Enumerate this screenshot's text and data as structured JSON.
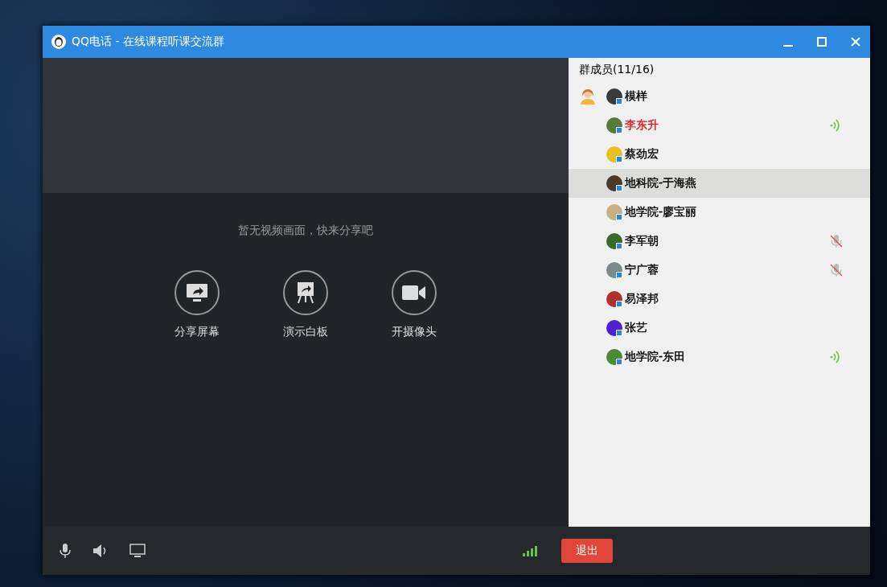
{
  "window": {
    "title": "QQ电话 - 在线课程听课交流群"
  },
  "video": {
    "message": "暂无视频画面，快来分享吧",
    "actions": [
      {
        "kind": "screen",
        "label": "分享屏幕"
      },
      {
        "kind": "whiteboard",
        "label": "演示白板"
      },
      {
        "kind": "camera",
        "label": "开摄像头"
      }
    ]
  },
  "members": {
    "header": "群成员(11/16)",
    "items": [
      {
        "name": "模样",
        "host": true,
        "speaking": false,
        "muted": false,
        "selected": false,
        "color": "#000000"
      },
      {
        "name": "李东升",
        "host": false,
        "speaking": true,
        "muted": false,
        "selected": false,
        "color": "#e8141e"
      },
      {
        "name": "蔡劲宏",
        "host": false,
        "speaking": false,
        "muted": false,
        "selected": false,
        "color": "#000000"
      },
      {
        "name": "地科院-于海燕",
        "host": false,
        "speaking": false,
        "muted": false,
        "selected": true,
        "color": "#000000"
      },
      {
        "name": "地学院-廖宝丽",
        "host": false,
        "speaking": false,
        "muted": false,
        "selected": false,
        "color": "#000000"
      },
      {
        "name": "李军朝",
        "host": false,
        "speaking": false,
        "muted": true,
        "selected": false,
        "color": "#000000"
      },
      {
        "name": "宁广蓉",
        "host": false,
        "speaking": false,
        "muted": true,
        "selected": false,
        "color": "#000000"
      },
      {
        "name": "易泽邦",
        "host": false,
        "speaking": false,
        "muted": false,
        "selected": false,
        "color": "#000000"
      },
      {
        "name": "张艺",
        "host": false,
        "speaking": false,
        "muted": false,
        "selected": false,
        "color": "#000000"
      },
      {
        "name": "地学院-东田",
        "host": false,
        "speaking": true,
        "muted": false,
        "selected": false,
        "color": "#000000"
      }
    ]
  },
  "toolbar": {
    "exit_button": "退出"
  }
}
